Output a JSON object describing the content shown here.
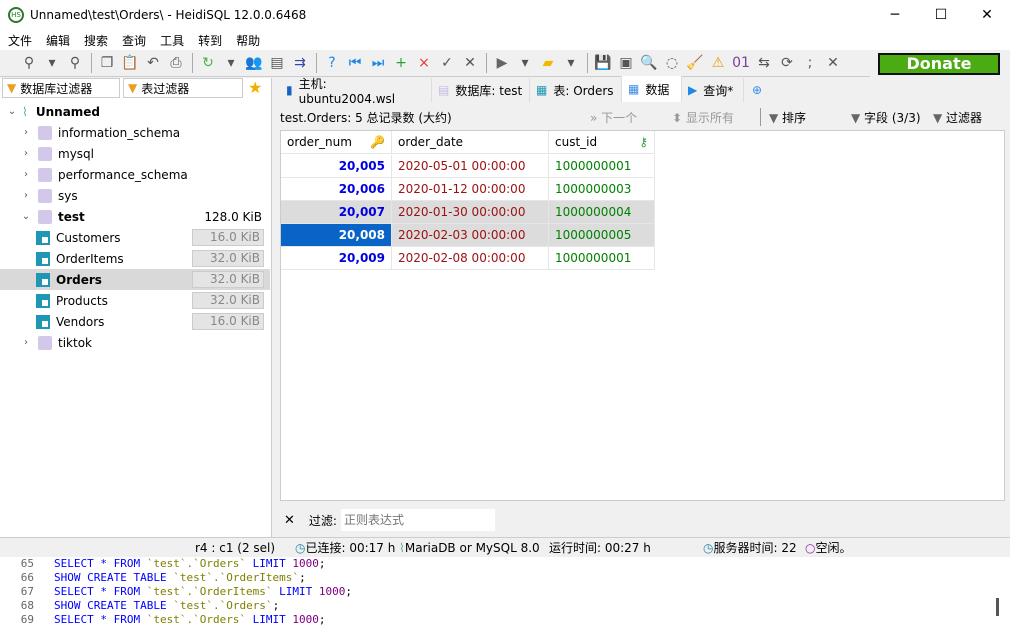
{
  "window": {
    "title": "Unnamed\\test\\Orders\\ - HeidiSQL 12.0.0.6468",
    "minimize": "─",
    "maximize": "☐",
    "close": "✕"
  },
  "menu": [
    "文件",
    "编辑",
    "搜索",
    "查询",
    "工具",
    "转到",
    "帮助"
  ],
  "toolbar": {
    "icons": [
      "connect-icon",
      "dropdown-icon",
      "disconnect-icon",
      "copy-icon",
      "paste-icon",
      "undo-icon",
      "print-icon",
      "refresh-icon",
      "dropdown-icon",
      "user-manager-icon",
      "export-csv-icon",
      "transfer-icon",
      "help-icon",
      "first-icon",
      "last-icon",
      "add-icon",
      "delete-icon",
      "apply-icon",
      "cancel-icon",
      "run-icon",
      "dropdown-icon",
      "open-folder-icon",
      "dropdown-icon",
      "save-icon",
      "save-disabled-icon",
      "find-icon",
      "replace-icon",
      "clean-icon",
      "warning-icon",
      "binary-icon",
      "wrap-icon",
      "sync-icon",
      "semicolon-icon",
      "close-query-icon"
    ],
    "donate": "Donate"
  },
  "left": {
    "db_filter": "数据库过滤器",
    "table_filter": "表过滤器",
    "tree": [
      {
        "label": "Unnamed",
        "level": 0,
        "type": "session",
        "expanded": true,
        "bold": true
      },
      {
        "label": "information_schema",
        "level": 1,
        "type": "db"
      },
      {
        "label": "mysql",
        "level": 1,
        "type": "db"
      },
      {
        "label": "performance_schema",
        "level": 1,
        "type": "db"
      },
      {
        "label": "sys",
        "level": 1,
        "type": "db"
      },
      {
        "label": "test",
        "level": 1,
        "type": "db",
        "expanded": true,
        "bold": true,
        "size": "128.0 KiB"
      },
      {
        "label": "Customers",
        "level": 2,
        "type": "table",
        "size": "16.0 KiB"
      },
      {
        "label": "OrderItems",
        "level": 2,
        "type": "table",
        "size": "32.0 KiB"
      },
      {
        "label": "Orders",
        "level": 2,
        "type": "table",
        "size": "32.0 KiB",
        "selected": true
      },
      {
        "label": "Products",
        "level": 2,
        "type": "table",
        "size": "32.0 KiB"
      },
      {
        "label": "Vendors",
        "level": 2,
        "type": "table",
        "size": "16.0 KiB"
      },
      {
        "label": "tiktok",
        "level": 1,
        "type": "db"
      }
    ]
  },
  "tabs": [
    {
      "label": "主机: ubuntu2004.wsl"
    },
    {
      "label": "数据库: test"
    },
    {
      "label": "表: Orders"
    },
    {
      "label": "数据",
      "active": true
    },
    {
      "label": "查询*"
    }
  ],
  "grid_toolbar": {
    "info": "test.Orders: 5 总记录数 (大约)",
    "next": "下一个",
    "show_all": "显示所有",
    "sort": "排序",
    "columns": "字段 (3/3)",
    "filter": "过滤器"
  },
  "grid": {
    "columns": [
      "order_num",
      "order_date",
      "cust_id"
    ],
    "rows": [
      [
        "20,005",
        "2020-05-01 00:00:00",
        "1000000001"
      ],
      [
        "20,006",
        "2020-01-12 00:00:00",
        "1000000003"
      ],
      [
        "20,007",
        "2020-01-30 00:00:00",
        "1000000004"
      ],
      [
        "20,008",
        "2020-02-03 00:00:00",
        "1000000005"
      ],
      [
        "20,009",
        "2020-02-08 00:00:00",
        "1000000001"
      ]
    ],
    "selected_row": 3
  },
  "filter_bar": {
    "label": "过滤:",
    "placeholder": "正则表达式"
  },
  "status": {
    "position": "r4 : c1 (2 sel)",
    "connected": "已连接: 00:17 h",
    "server": "MariaDB or MySQL 8.0",
    "uptime": "运行时间: 00:27 h",
    "server_time": "服务器时间: 22",
    "idle": "空闲。"
  },
  "log": [
    {
      "n": "65",
      "tokens": [
        [
          "kw",
          "SELECT * FROM "
        ],
        [
          "id",
          "`test`.`Orders`"
        ],
        [
          "kw",
          " LIMIT "
        ],
        [
          "num",
          "1000"
        ],
        [
          "pl",
          ";"
        ]
      ]
    },
    {
      "n": "66",
      "tokens": [
        [
          "kw",
          "SHOW CREATE TABLE "
        ],
        [
          "id",
          "`test`.`OrderItems`"
        ],
        [
          "pl",
          ";"
        ]
      ]
    },
    {
      "n": "67",
      "tokens": [
        [
          "kw",
          "SELECT * FROM "
        ],
        [
          "id",
          "`test`.`OrderItems`"
        ],
        [
          "kw",
          " LIMIT "
        ],
        [
          "num",
          "1000"
        ],
        [
          "pl",
          ";"
        ]
      ]
    },
    {
      "n": "68",
      "tokens": [
        [
          "kw",
          "SHOW CREATE TABLE "
        ],
        [
          "id",
          "`test`.`Orders`"
        ],
        [
          "pl",
          ";"
        ]
      ]
    },
    {
      "n": "69",
      "tokens": [
        [
          "kw",
          "SELECT * FROM "
        ],
        [
          "id",
          "`test`.`Orders`"
        ],
        [
          "kw",
          " LIMIT "
        ],
        [
          "num",
          "1000"
        ],
        [
          "pl",
          ";"
        ]
      ]
    }
  ]
}
